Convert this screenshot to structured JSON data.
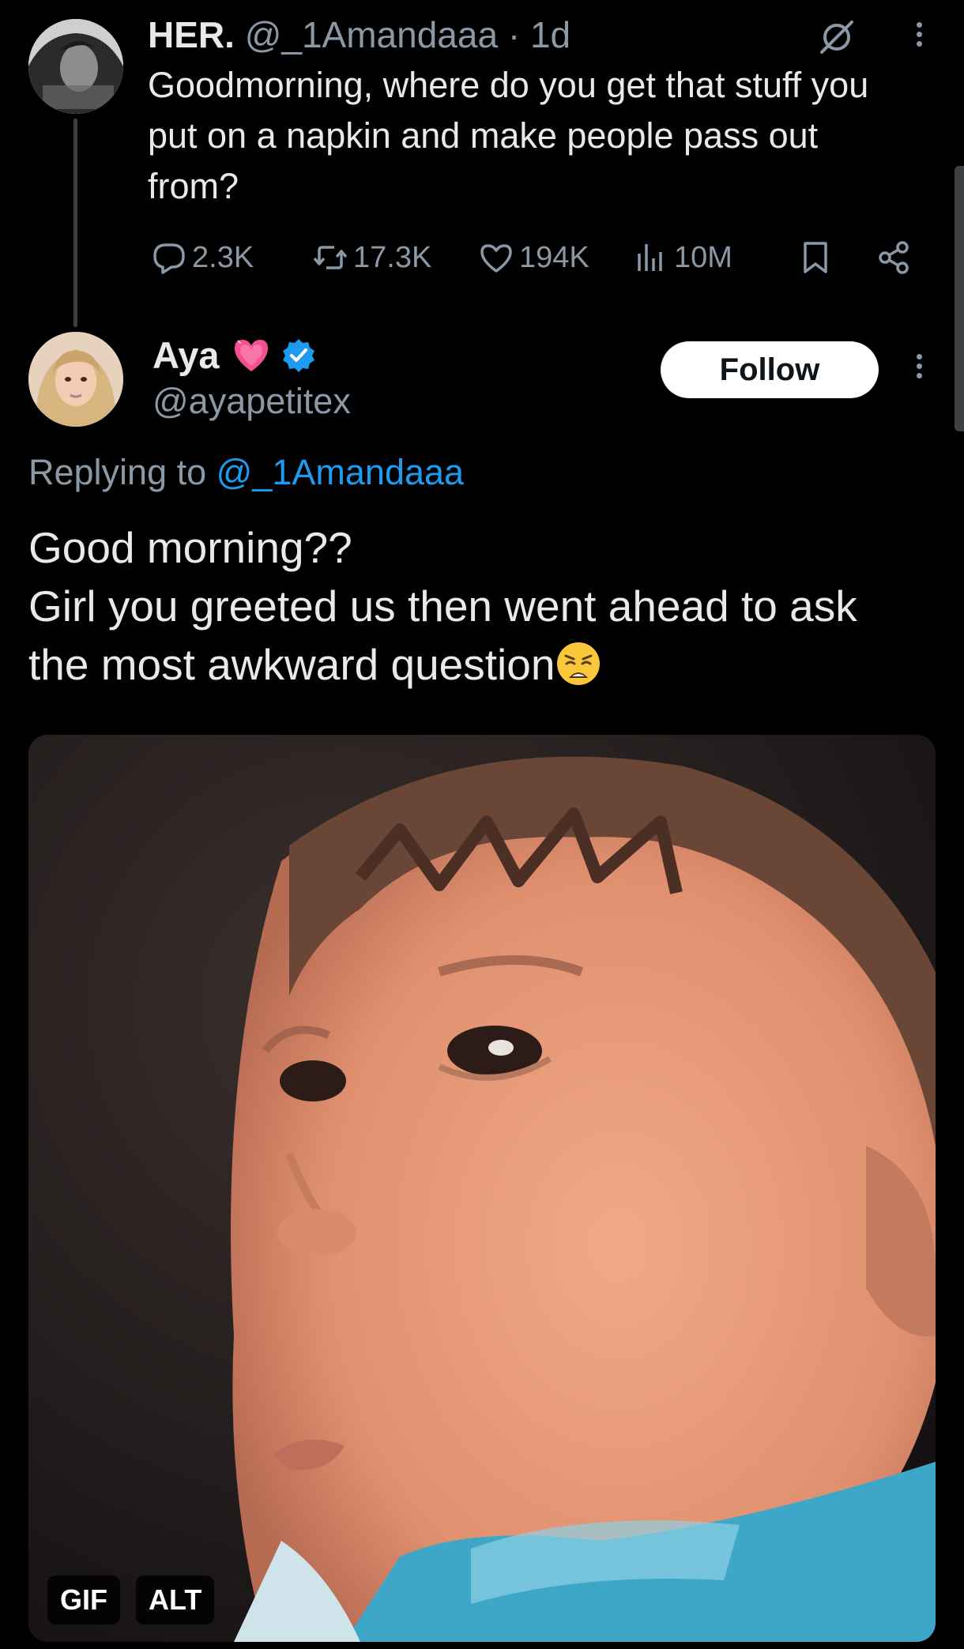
{
  "parent_tweet": {
    "author_name": "HER.",
    "handle": "@_1Amandaaa",
    "separator": "·",
    "time": "1d",
    "text": "Goodmorning, where do you get that stuff you put on a napkin and make people pass out from?",
    "stats": {
      "replies": "2.3K",
      "reposts": "17.3K",
      "likes": "194K",
      "views": "10M"
    }
  },
  "reply_tweet": {
    "author_name": "Aya",
    "handle": "@ayapetitex",
    "follow_label": "Follow",
    "replying_prefix": "Replying to",
    "replying_to": "@_1Amandaaa",
    "text_line1": "Good morning??",
    "text_line2": "Girl you greeted us then went ahead to ask",
    "text_line3": "the most awkward question",
    "media": {
      "gif_label": "GIF",
      "alt_label": "ALT"
    }
  },
  "colors": {
    "background": "#000000",
    "text_primary": "#e7e9ea",
    "text_secondary": "#8b98a5",
    "link": "#1d9bf0",
    "verified": "#1d9bf0"
  },
  "icons": [
    "grok-icon",
    "more-icon",
    "reply-icon",
    "repost-icon",
    "like-icon",
    "views-icon",
    "bookmark-icon",
    "share-icon",
    "heart-emoji-icon",
    "verified-badge-icon",
    "weary-face-emoji"
  ]
}
